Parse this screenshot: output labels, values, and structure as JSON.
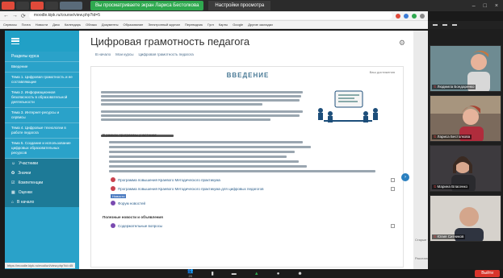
{
  "zoom": {
    "banner_text": "Вы просматриваете экран Лариса Бестолкова",
    "settings_label": "Настройки просмотра",
    "window_controls": [
      "–",
      "□",
      "×"
    ],
    "toolbar": [
      {
        "icon": "participants-icon",
        "label": "Участники",
        "count": "20"
      },
      {
        "icon": "chart-icon",
        "label": "Опрос"
      },
      {
        "icon": "chat-icon",
        "label": "Чат"
      },
      {
        "icon": "share-screen-icon",
        "label": "Демонстрация экрана"
      },
      {
        "icon": "record-icon",
        "label": "Запись"
      },
      {
        "icon": "reactions-icon",
        "label": "Реакции"
      }
    ],
    "leave_label": "Выйти",
    "accent_green": "#2fa84f",
    "leave_color": "#d9342b"
  },
  "browser": {
    "url": "moodle.kipk.ru/course/view.php?id=5",
    "bookmarks": [
      "Сервисы",
      "Почта",
      "Новости",
      "Диск",
      "Календарь",
      "Облако",
      "Документы",
      "Образование",
      "Электронный журнал",
      "Переводчик",
      "Гугл",
      "Карты",
      "Google",
      "Другие закладки"
    ]
  },
  "moodle": {
    "course_menu_title": "Разделы курса",
    "sidebar_sections": [
      "Введение",
      "Тема 1. Цифровая грамотность и ее составляющие",
      "Тема 2. Информационная безопасность в образовательной деятельности",
      "Тема 3. Интернет-ресурсы и сервисы",
      "Тема 4. Цифровые технологии в работе педагога",
      "Тема 5. Создание и использование цифровых образовательных ресурсов"
    ],
    "sidebar_nav": [
      {
        "icon": "participants-icon",
        "label": "Участники"
      },
      {
        "icon": "badge-icon",
        "label": "Значки"
      },
      {
        "icon": "competency-icon",
        "label": "Компетенции"
      },
      {
        "icon": "grades-icon",
        "label": "Оценки"
      },
      {
        "icon": "home-icon",
        "label": "В начало"
      }
    ],
    "page_title": "Цифровая грамотность педагога",
    "breadcrumb": [
      "В начало",
      "Мои курсы",
      "Цифровая грамотность педагога"
    ],
    "section_title": "ВВЕДЕНИЕ",
    "your_progress": "Ваш достижения",
    "program_heading": "В рамках программы участники:",
    "resources": [
      "Программа повышения Краевого Методического практикума",
      "Программа повышения Краевого Методического практикума для цифровых педагогов"
    ],
    "forum_label": "Форум новостей",
    "forum_badge": "Новости",
    "section_news": "Полезные новости и объявления",
    "questions_label": "Содержательные вопросы",
    "status_url": "https://moodle.kipk.ru/mod/url/view.php?id=45",
    "right_panel_items": [
      "Старые темы...",
      "Расстановка"
    ],
    "sidebar_color": "#2aa2c9",
    "title_color": "#4a7a96"
  },
  "participants": [
    {
      "name": "Людмила Бондаренко",
      "muted": true
    },
    {
      "name": "Лариса Бестолкова",
      "muted": true
    },
    {
      "name": "Марина Власенко",
      "muted": true
    },
    {
      "name": "Юлия Ситников",
      "muted": true
    }
  ]
}
